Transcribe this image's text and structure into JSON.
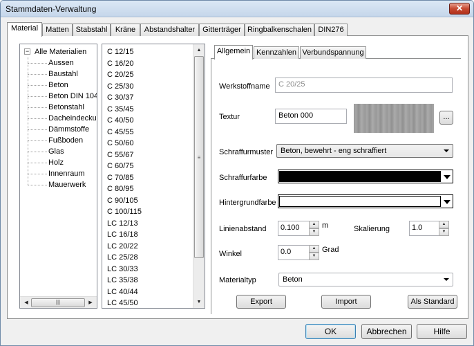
{
  "window": {
    "title": "Stammdaten-Verwaltung",
    "close_glyph": "✕"
  },
  "tabs": [
    "Material",
    "Matten",
    "Stabstahl",
    "Kräne",
    "Abstandshalter",
    "Gitterträger",
    "Ringbalkenschalen",
    "DIN276"
  ],
  "tree": {
    "root": "Alle Materialien",
    "items": [
      "Aussen",
      "Baustahl",
      "Beton",
      "Beton DIN 104",
      "Betonstahl",
      "Dacheindeckung",
      "Dämmstoffe",
      "Fußboden",
      "Glas",
      "Holz",
      "Innenraum",
      "Mauerwerk"
    ]
  },
  "materials": [
    "C 12/15",
    "C 16/20",
    "C 20/25",
    "C 25/30",
    "C 30/37",
    "C 35/45",
    "C 40/50",
    "C 45/55",
    "C 50/60",
    "C 55/67",
    "C 60/75",
    "C 70/85",
    "C 80/95",
    "C 90/105",
    "C 100/115",
    "LC 12/13",
    "LC 16/18",
    "LC 20/22",
    "LC 25/28",
    "LC 30/33",
    "LC 35/38",
    "LC 40/44",
    "LC 45/50"
  ],
  "detail_tabs": [
    "Allgemein",
    "Kennzahlen",
    "Verbundspannung"
  ],
  "form": {
    "werkstoffname_label": "Werkstoffname",
    "werkstoffname_value": "C 20/25",
    "textur_label": "Textur",
    "textur_value": "Beton 000",
    "browse_label": "...",
    "schraffurmuster_label": "Schraffurmuster",
    "schraffurmuster_value": "Beton, bewehrt - eng schraffiert",
    "schraffurfarbe_label": "Schraffurfarbe",
    "schraffurfarbe_color": "#000000",
    "hintergrundfarbe_label": "Hintergrundfarbe",
    "hintergrundfarbe_color": "#ffffff",
    "linienabstand_label": "Linienabstand",
    "linienabstand_value": "0.100",
    "linienabstand_unit": "m",
    "skalierung_label": "Skalierung",
    "skalierung_value": "1.0",
    "winkel_label": "Winkel",
    "winkel_value": "0.0",
    "winkel_unit": "Grad",
    "materialtyp_label": "Materialtyp",
    "materialtyp_value": "Beton"
  },
  "panel_buttons": {
    "export": "Export",
    "import": "Import",
    "standard": "Als Standard"
  },
  "footer_buttons": {
    "ok": "OK",
    "cancel": "Abbrechen",
    "help": "Hilfe"
  },
  "scroll_glyphs": {
    "left": "◀",
    "right": "▶",
    "up": "▲",
    "down": "▼",
    "grip_h": "|||",
    "grip_v": "≡"
  },
  "tree_expander": "−"
}
